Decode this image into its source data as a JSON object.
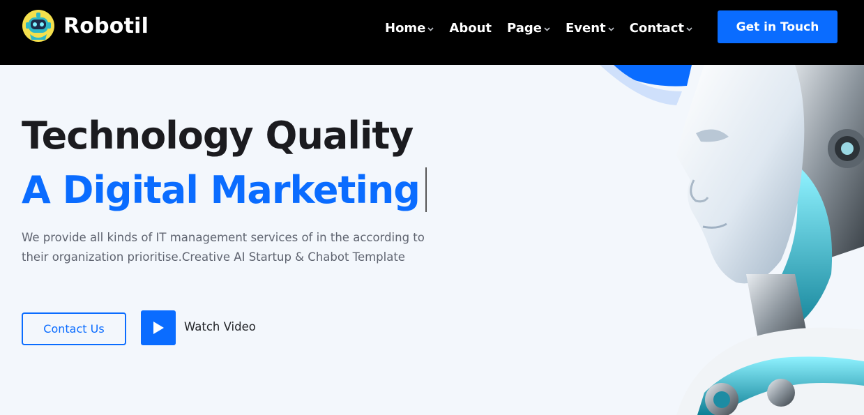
{
  "header": {
    "logo_text": "Robotil",
    "nav": [
      {
        "label": "Home",
        "has_dropdown": true
      },
      {
        "label": "About",
        "has_dropdown": false
      },
      {
        "label": "Page",
        "has_dropdown": true
      },
      {
        "label": "Event",
        "has_dropdown": true
      },
      {
        "label": "Contact",
        "has_dropdown": true
      }
    ],
    "cta_label": "Get in Touch"
  },
  "hero": {
    "title_line_1": "Technology Quality",
    "title_line_2": "A Digital Marketing",
    "description": "We provide all kinds of IT management services of in the according to their organization prioritise.Creative AI Startup & Chabot Template",
    "primary_button": "Contact Us",
    "video_label": "Watch Video"
  },
  "colors": {
    "accent": "#0a6cff",
    "header_bg": "#000000",
    "hero_bg": "#f3f7fc",
    "title": "#1b1b1f",
    "body_text": "#5f6470"
  },
  "icons": {
    "logo": "robot-mascot-icon",
    "dropdown": "chevron-down-icon",
    "video": "play-icon"
  }
}
